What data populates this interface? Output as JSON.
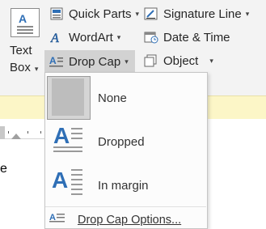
{
  "ribbon": {
    "quick_parts": "Quick Parts",
    "wordart": "WordArt",
    "drop_cap": "Drop Cap",
    "signature_line": "Signature Line",
    "date_time": "Date & Time",
    "object": "Object",
    "text_box_line1": "Text",
    "text_box_line2": "Box",
    "textbox_icon_letter": "A"
  },
  "document": {
    "visible_text": "e"
  },
  "drop_cap_menu": {
    "items": [
      {
        "label": "None",
        "icon": "drop-cap-none-icon",
        "selected": true
      },
      {
        "label": "Dropped",
        "icon": "drop-cap-dropped-icon",
        "selected": false
      },
      {
        "label": "In margin",
        "icon": "drop-cap-in-margin-icon",
        "selected": false
      }
    ],
    "options_label": "Drop Cap Options..."
  },
  "colors": {
    "accent": "#2f6fb6",
    "highlight": "#d2d2d2",
    "message_bar": "#fcf6c7"
  }
}
